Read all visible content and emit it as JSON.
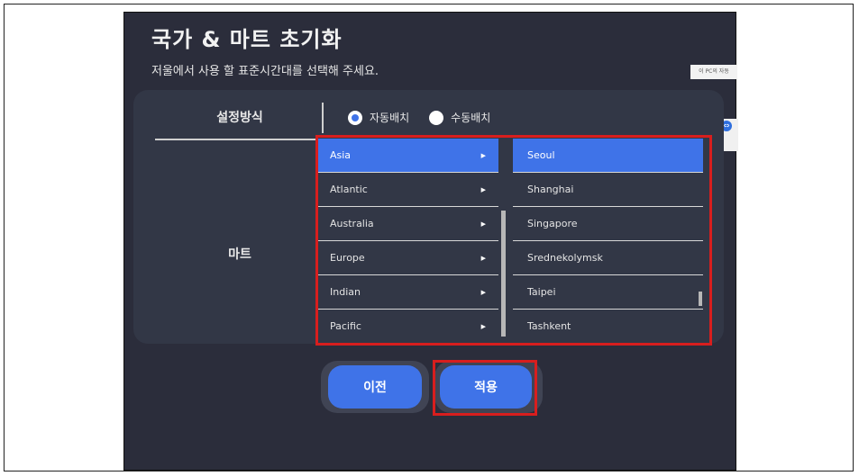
{
  "page": {
    "title": "국가 & 마트 초기화",
    "subtitle": "저울에서 사용 할 표준시간대를 선택해 주세요.",
    "tooltip": "이 PC의 자동"
  },
  "settings": {
    "label": "설정방식",
    "options": [
      {
        "label": "자동배치",
        "checked": true
      },
      {
        "label": "수동배치",
        "checked": false
      }
    ]
  },
  "mart": {
    "label": "마트"
  },
  "regions": [
    {
      "label": "Asia",
      "selected": true
    },
    {
      "label": "Atlantic",
      "selected": false
    },
    {
      "label": "Australia",
      "selected": false
    },
    {
      "label": "Europe",
      "selected": false
    },
    {
      "label": "Indian",
      "selected": false
    },
    {
      "label": "Pacific",
      "selected": false
    }
  ],
  "cities": [
    {
      "label": "Seoul",
      "selected": true
    },
    {
      "label": "Shanghai",
      "selected": false
    },
    {
      "label": "Singapore",
      "selected": false
    },
    {
      "label": "Srednekolymsk",
      "selected": false
    },
    {
      "label": "Taipei",
      "selected": false
    },
    {
      "label": "Tashkent",
      "selected": false
    }
  ],
  "buttons": {
    "prev": "이전",
    "apply": "적용"
  },
  "colors": {
    "background": "#2b2d3b",
    "panel": "#323746",
    "accent": "#3f73e8",
    "highlight_box": "#d81e1e"
  }
}
